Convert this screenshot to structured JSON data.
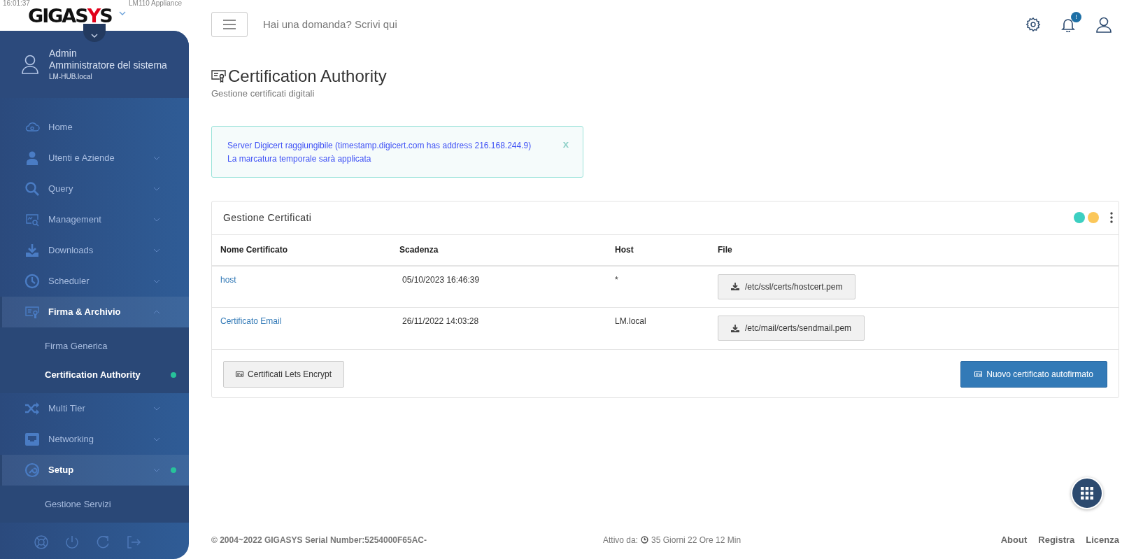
{
  "status": {
    "clock": "16:01:37",
    "appliance": "LM110 Appliance"
  },
  "logo": [
    {
      "text": "GIGAS",
      "color": "#111111"
    },
    {
      "text": "Y",
      "color": "#e2001a"
    },
    {
      "text": "S",
      "color": "#111111"
    }
  ],
  "user": {
    "name": "Admin",
    "role": "Amministratore del sistema",
    "host": "LM-HUB.local"
  },
  "menu": [
    {
      "label": "Home",
      "kind": "link",
      "expanded": false,
      "selected": false
    },
    {
      "label": "Utenti e Aziende",
      "kind": "group",
      "expanded": false,
      "selected": false
    },
    {
      "label": "Query",
      "kind": "group",
      "expanded": false,
      "selected": false
    },
    {
      "label": "Management",
      "kind": "group",
      "expanded": false,
      "selected": false
    },
    {
      "label": "Downloads",
      "kind": "group",
      "expanded": false,
      "selected": false
    },
    {
      "label": "Scheduler",
      "kind": "group",
      "expanded": false,
      "selected": false
    },
    {
      "label": "Firma & Archivio",
      "kind": "group",
      "expanded": true,
      "selected": false,
      "children": [
        {
          "label": "Firma Generica",
          "selected": false
        },
        {
          "label": "Certification Authority",
          "selected": true
        }
      ]
    },
    {
      "label": "Multi Tier",
      "kind": "group",
      "expanded": false,
      "selected": false
    },
    {
      "label": "Networking",
      "kind": "group",
      "expanded": false,
      "selected": false
    },
    {
      "label": "Setup",
      "kind": "group",
      "expanded": false,
      "selected": true,
      "children": [
        {
          "label": "Gestione Servizi",
          "selected": false
        }
      ]
    }
  ],
  "search": {
    "placeholder": "Hai una domanda? Scrivi qui"
  },
  "notifications": {
    "badge": "!"
  },
  "page": {
    "title": "Certification Authority",
    "subtitle": "Gestione certificati digitali"
  },
  "alert": {
    "lines": [
      "Server Digicert raggiungibile (timestamp.digicert.com has address 216.168.244.9)",
      "La marcatura temporale sarà applicata"
    ],
    "close": "x"
  },
  "card": {
    "title": "Gestione Certificati",
    "dots": [
      {
        "color": "#3ccfc1"
      },
      {
        "color": "#fbc75a"
      }
    ],
    "columns": [
      "Nome Certificato",
      "Scadenza",
      "Host",
      "File"
    ],
    "rows": [
      {
        "name": "host",
        "expiry": "05/10/2023 16:46:39",
        "host": "*",
        "file": "/etc/ssl/certs/hostcert.pem"
      },
      {
        "name": "Certificato Email",
        "expiry": "26/11/2022 14:03:28",
        "host": "LM.local",
        "file": "/etc/mail/certs/sendmail.pem"
      }
    ],
    "buttons": [
      {
        "label": "Certificati Lets Encrypt",
        "kind": "secondary"
      },
      {
        "label": "Nuovo certificato autofirmato",
        "kind": "primary"
      }
    ]
  },
  "footer": {
    "copyright": "© 2004~2022 GIGASYS Serial Number:5254000F65AC-",
    "uptime_label": "Attivo da:",
    "uptime": "35 Giorni 22 Ore 12 Min",
    "links": [
      "About",
      "Registra",
      "Licenza"
    ]
  }
}
